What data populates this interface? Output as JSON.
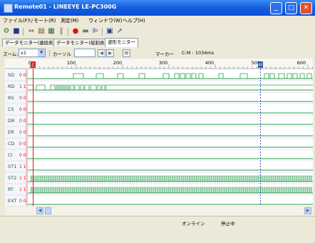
{
  "window": {
    "title": "Remote01 - LINEEYE LE-PC300G",
    "minimize": "_",
    "maximize": "□",
    "close": "✕"
  },
  "menu": [
    "ファイル(F)",
    "リモート(R)",
    "測定(M)",
    "ウィンドウ(W)",
    "ヘルプ(H)"
  ],
  "toolbar": {
    "icons": [
      "gear-icon",
      "save-icon",
      "arrows-icon",
      "copy-icon",
      "print-icon",
      "pause-icon",
      "record-icon",
      "stop-icon",
      "filter-icon",
      "display-icon",
      "pointer-icon"
    ]
  },
  "tabs": [
    {
      "label": "データモニター(連続表示)",
      "active": false
    },
    {
      "label": "データモニター(縦割表示)",
      "active": false
    },
    {
      "label": "波形モニター",
      "active": true
    }
  ],
  "controls": {
    "zoom_label": "ズーム:",
    "zoom_value": "x1",
    "cursor_label": "カーソル",
    "marker_label": "マーカー",
    "cm_readout": "C-M : 1034ms"
  },
  "ruler": {
    "ticks": [
      "0",
      "100",
      "200",
      "300",
      "400",
      "500",
      "600"
    ],
    "cursor_mark": "C",
    "marker_mark": "M"
  },
  "signals": [
    {
      "name": "SD",
      "level": "0 0"
    },
    {
      "name": "RD",
      "level": "1 1"
    },
    {
      "name": "RS",
      "level": "0 0"
    },
    {
      "name": "CS",
      "level": "0 0"
    },
    {
      "name": "DR",
      "level": "0 0"
    },
    {
      "name": "ER",
      "level": "0 0"
    },
    {
      "name": "CD",
      "level": "0 0"
    },
    {
      "name": "CI",
      "level": "0 0"
    },
    {
      "name": "ST1",
      "level": "1 1"
    },
    {
      "name": "ST2",
      "level": "1 1"
    },
    {
      "name": "RT",
      "level": "1 1"
    },
    {
      "name": "EXT",
      "level": "0 0"
    }
  ],
  "colors": {
    "signal_line": "#2a9a4a",
    "trace": "#2a9a4a",
    "cursor_line": "#d02020",
    "marker_line": "#2a5aa8",
    "name_text": "#1a5c2a",
    "level_text": "#d02020"
  },
  "status": {
    "online": "オンライン",
    "state": "停止中"
  }
}
